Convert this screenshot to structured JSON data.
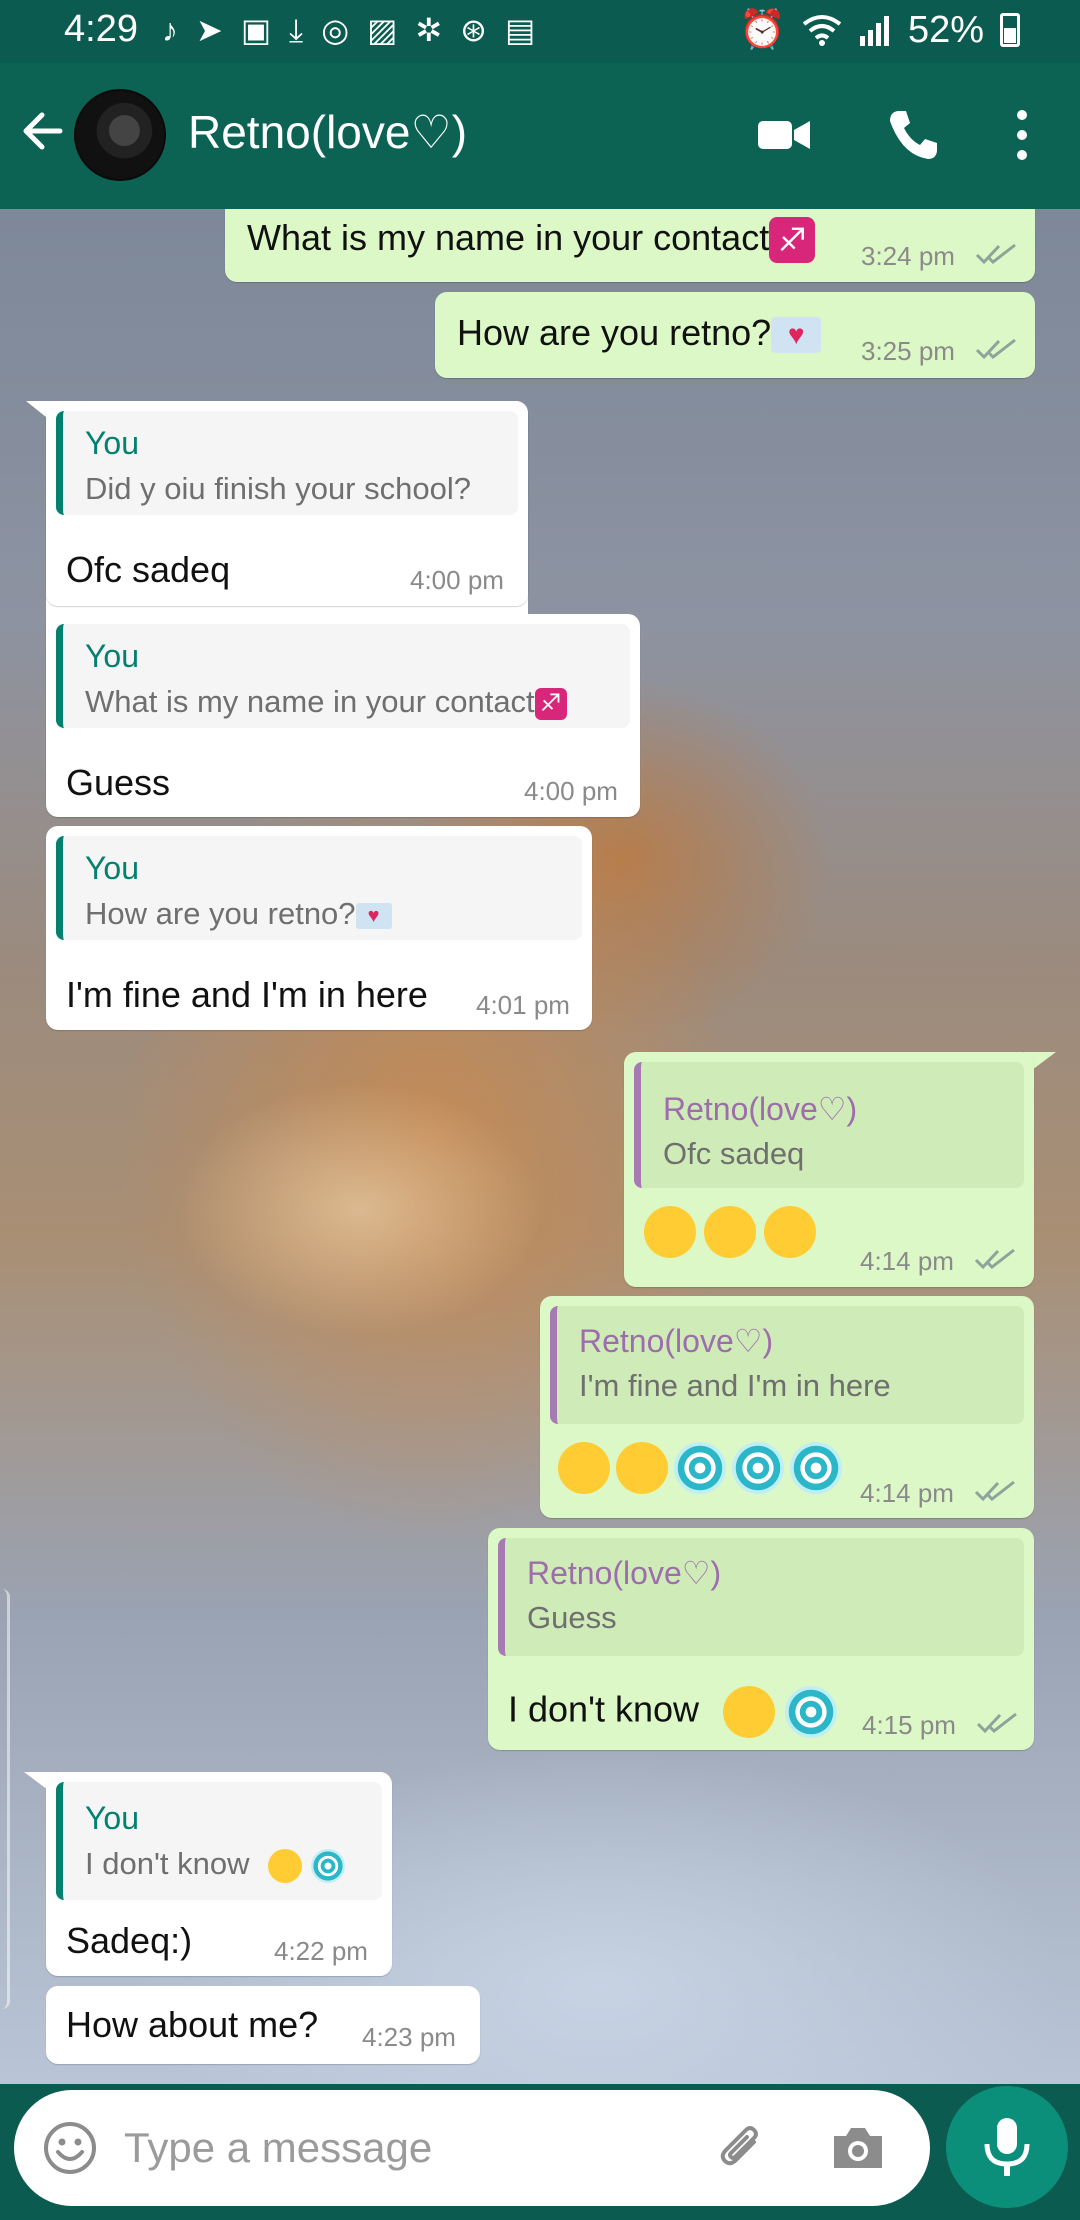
{
  "status_bar": {
    "time": "4:29",
    "battery": "52%",
    "notification_icons": [
      "music-note-icon",
      "telegram-icon",
      "app-icon",
      "download-icon",
      "instagram-icon",
      "gallery-icon",
      "translate-icon",
      "vpn-icon",
      "translate-g-icon"
    ]
  },
  "header": {
    "contact_name": "Retno(love♡)"
  },
  "messages": [
    {
      "id": "m1",
      "direction": "out",
      "text": "What is my name in your contact",
      "emoji": "sagittarius",
      "time": "3:24 pm"
    },
    {
      "id": "m2",
      "direction": "out",
      "text": "How are you  retno?",
      "emoji": "love-letter",
      "time": "3:25 pm"
    },
    {
      "id": "m3",
      "direction": "in",
      "quote_author": "You",
      "quote_text": "Did y oiu finish your school?",
      "text": "Ofc sadeq",
      "time": "4:00 pm"
    },
    {
      "id": "m4",
      "direction": "in",
      "quote_author": "You",
      "quote_text": "What is my name in your contact",
      "text": "Guess",
      "time": "4:00 pm"
    },
    {
      "id": "m5",
      "direction": "in",
      "quote_author": "You",
      "quote_text": "How are you  retno?",
      "text": "I'm fine and I'm in here",
      "time": "4:01 pm"
    },
    {
      "id": "m6",
      "direction": "out",
      "quote_author": "Retno(love♡)",
      "quote_text": "Ofc sadeq",
      "text": "",
      "time": "4:14 pm"
    },
    {
      "id": "m7",
      "direction": "out",
      "quote_author": "Retno(love♡)",
      "quote_text": "I'm fine and I'm in here",
      "text": "",
      "time": "4:14 pm"
    },
    {
      "id": "m8",
      "direction": "out",
      "quote_author": "Retno(love♡)",
      "quote_text": "Guess",
      "text": "I don't know",
      "time": "4:15 pm"
    },
    {
      "id": "m9",
      "direction": "in",
      "quote_author": "You",
      "quote_text": "I don't know",
      "text": "Sadeq:)",
      "time": "4:22 pm"
    },
    {
      "id": "m10",
      "direction": "in",
      "text": "How about me?",
      "time": "4:23 pm"
    }
  ],
  "input": {
    "placeholder": "Type a message"
  },
  "colors": {
    "header": "#0c6354",
    "outgoing_bubble": "#dcf8c6",
    "incoming_bubble": "#ffffff",
    "accent": "#0b8f7b",
    "quote_you": "#04806f",
    "quote_contact": "#9e6dab"
  }
}
